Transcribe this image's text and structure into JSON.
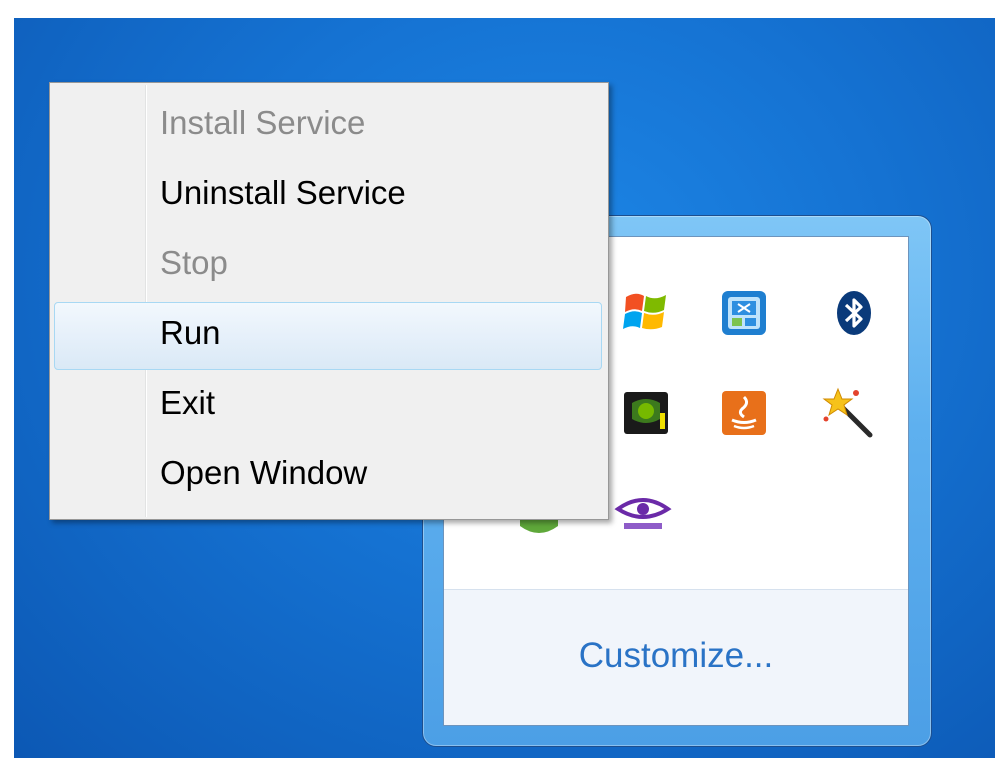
{
  "context_menu": {
    "items": [
      {
        "label": "Install Service",
        "enabled": false
      },
      {
        "label": "Uninstall Service",
        "enabled": true
      },
      {
        "label": "Stop",
        "enabled": false
      },
      {
        "label": "Run",
        "enabled": true,
        "highlighted": true
      },
      {
        "label": "Exit",
        "enabled": true
      },
      {
        "label": "Open Window",
        "enabled": true
      }
    ]
  },
  "tray": {
    "customize_label": "Customize...",
    "icons": [
      "windows-flag-icon",
      "blue-app-icon",
      "bluetooth-icon",
      "gpu-icon",
      "java-icon",
      "magic-wand-icon",
      "green-app-icon",
      "eye-icon"
    ]
  },
  "colors": {
    "desktop": "#1572d2",
    "menu_background": "#f0f0f0",
    "menu_highlight_border": "#a8d8f3",
    "link": "#2a73c6",
    "disabled_text": "#8b8b8b"
  }
}
